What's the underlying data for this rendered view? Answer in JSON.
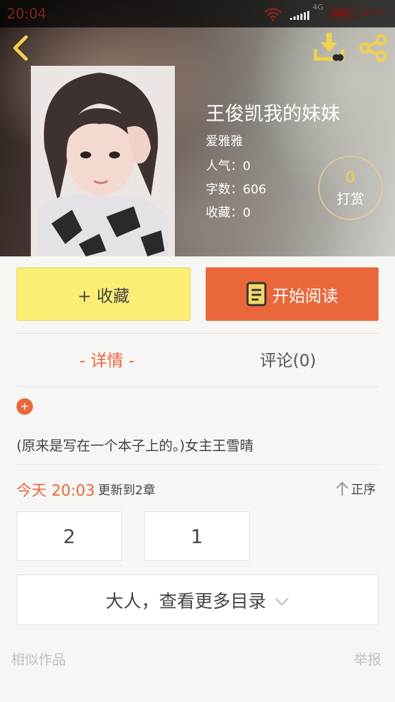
{
  "status_bar": {
    "time": "20:04",
    "network": "4G",
    "battery": "69%"
  },
  "header": {
    "icons": [
      "back-icon",
      "download-icon",
      "share-icon"
    ]
  },
  "book": {
    "title": "王俊凯我的妹妹",
    "author": "爱雅雅",
    "popularity": "人气：0",
    "word_count": "字数：606",
    "favorites": "收藏：0",
    "tip_count": "0",
    "tip_label": "打赏"
  },
  "actions": {
    "collect_label": "+ 收藏",
    "read_label": "开始阅读"
  },
  "tabs": {
    "detail_label": "- 详情 -",
    "comment_label": "评论(0)"
  },
  "detail": {
    "expand_symbol": "+",
    "description": "(原来是写在一个本子上的。)女主王雪晴"
  },
  "updates": {
    "time": "今天 20:03",
    "text": "更新到2章",
    "sort_label": "正序"
  },
  "chapters": [
    "2",
    "1"
  ],
  "more_label": "大人，查看更多目录",
  "footer": {
    "similar_label": "相似作品",
    "report_label": "举报"
  },
  "colors": {
    "accent": "#e9673a",
    "collect_button": "#fbee74",
    "tip_number": "#f2d24a"
  }
}
